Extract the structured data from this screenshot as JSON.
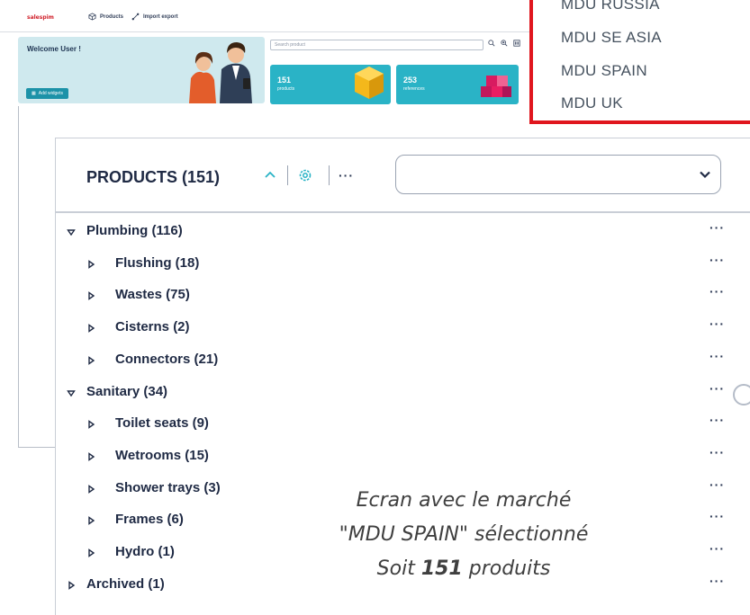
{
  "app": {
    "logo": "salespim",
    "nav": [
      {
        "label": "Products",
        "icon": "cube-icon"
      },
      {
        "label": "Import export",
        "icon": "share-icon"
      }
    ],
    "welcome": "Welcome User !",
    "add_widgets": "Add widgets",
    "search_placeholder": "Search product",
    "stats": [
      {
        "value": "151",
        "label": "products"
      },
      {
        "value": "253",
        "label": "references"
      }
    ]
  },
  "market_menu": {
    "items": [
      "MDU RUSSIA",
      "MDU SE ASIA",
      "MDU SPAIN",
      "MDU UK"
    ],
    "border_color": "#e0161e"
  },
  "panel": {
    "title": "PRODUCTS (151)",
    "select_value": "",
    "more": "···"
  },
  "tree": [
    {
      "label": "Plumbing (116)",
      "level": 0,
      "expanded": true
    },
    {
      "label": "Flushing (18)",
      "level": 1,
      "expanded": false
    },
    {
      "label": "Wastes (75)",
      "level": 1,
      "expanded": false
    },
    {
      "label": "Cisterns (2)",
      "level": 1,
      "expanded": false
    },
    {
      "label": "Connectors (21)",
      "level": 1,
      "expanded": false
    },
    {
      "label": "Sanitary (34)",
      "level": 0,
      "expanded": true
    },
    {
      "label": "Toilet seats (9)",
      "level": 1,
      "expanded": false
    },
    {
      "label": "Wetrooms (15)",
      "level": 1,
      "expanded": false
    },
    {
      "label": "Shower trays (3)",
      "level": 1,
      "expanded": false
    },
    {
      "label": "Frames (6)",
      "level": 1,
      "expanded": false
    },
    {
      "label": "Hydro (1)",
      "level": 1,
      "expanded": false
    },
    {
      "label": "Archived (1)",
      "level": 0,
      "expanded": false
    }
  ],
  "caption": {
    "line1": "Ecran avec le marché",
    "line2": "\"MDU SPAIN\" sélectionné",
    "line3_prefix": "Soit ",
    "line3_bold": "151",
    "line3_suffix": " produits"
  },
  "colors": {
    "accent": "#2ab3c6",
    "brand": "#d0202a",
    "text": "#1f2a44"
  }
}
